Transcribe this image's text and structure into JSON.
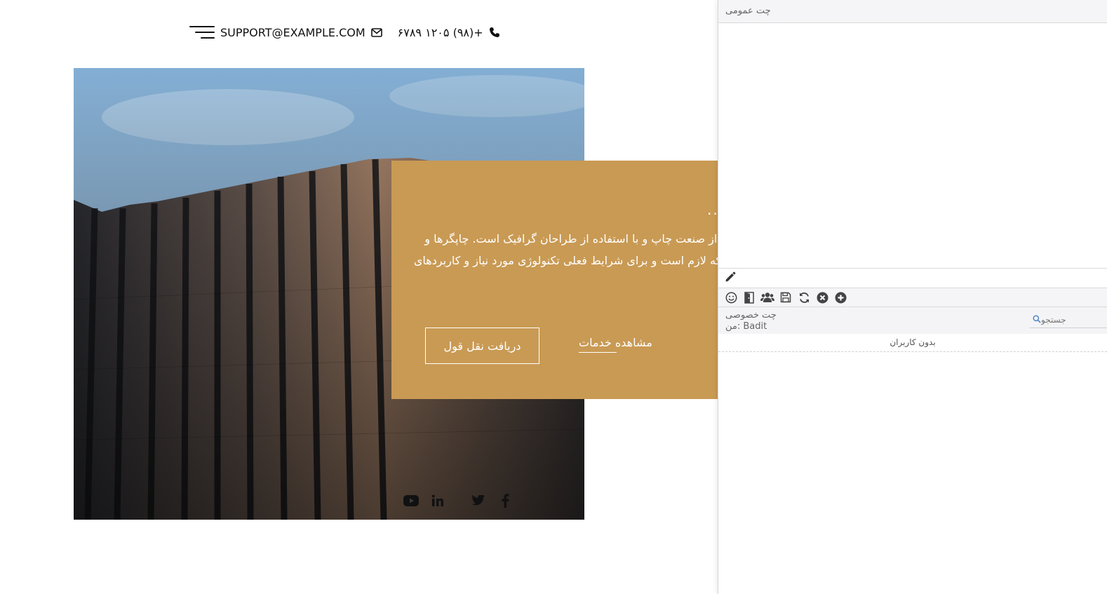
{
  "header": {
    "phone": "+(۹۸) ۱۲۰۵ ۶۷۸۹",
    "email": "SUPPORT@EXAMPLE.COM"
  },
  "hero_card": {
    "dots": "..",
    "paragraph_line1": "وم از صنعت چاپ و با استفاده از طراحان گرافیک است. چاپگرها و",
    "paragraph_line2": "ن که لازم است و برای شرایط فعلی تکنولوژی مورد نیاز و کاربردهای",
    "quote_button": "دریافت نقل قول",
    "services_link": "مشاهده خدمات"
  },
  "socials": [
    "youtube-icon",
    "linkedin-icon",
    "twitter-icon",
    "facebook-icon"
  ],
  "chat": {
    "public_title": "چت عمومی",
    "private_title": "چت خصوصی",
    "me_label": "من: Badit",
    "search_placeholder": "جستجو",
    "no_users": "بدون کاربران",
    "toolbar_icons": [
      "smiley-icon",
      "exit-door-icon",
      "users-icon",
      "save-icon",
      "refresh-icon",
      "close-circle-icon",
      "add-circle-icon"
    ]
  },
  "colors": {
    "card_bg": "#C99A54",
    "chat_header_bg": "#f5f5f7",
    "sky": "#8fb6d8"
  }
}
